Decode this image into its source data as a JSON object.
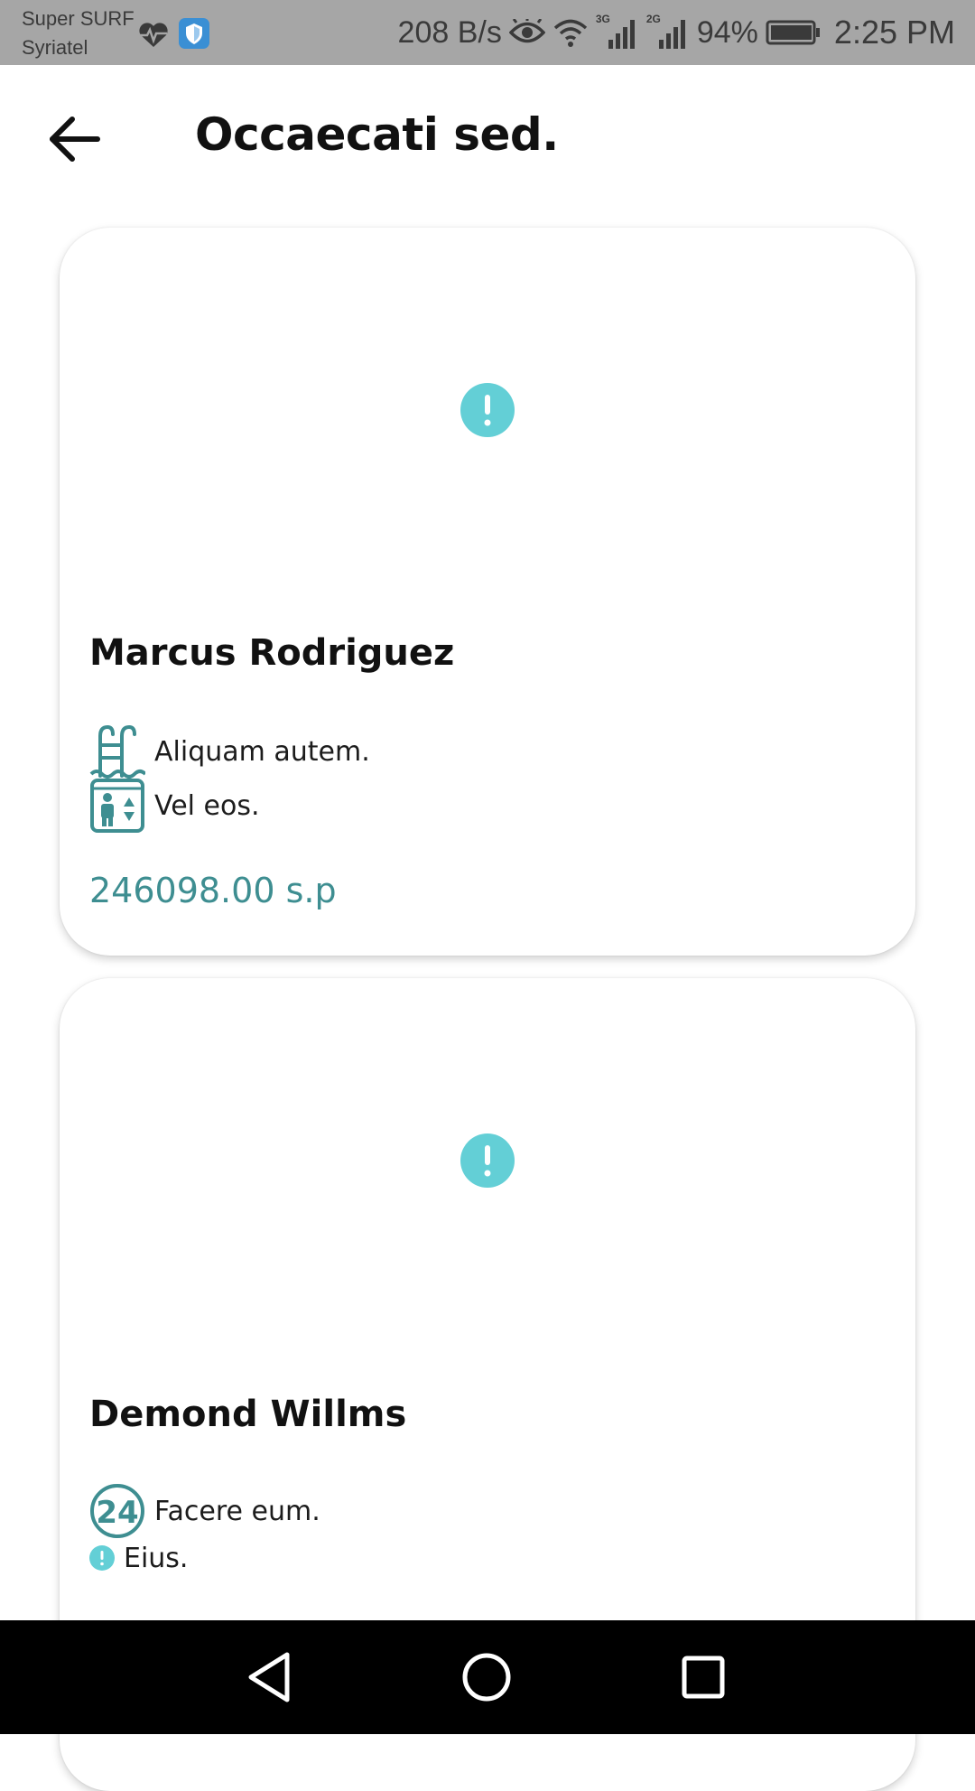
{
  "status_bar": {
    "carrier_line1": "Super SURF",
    "carrier_line2": "Syriatel",
    "net_speed": "208 B/s",
    "signal1_label": "3G",
    "signal2_label": "2G",
    "battery_percent": "94%",
    "time": "2:25 PM",
    "icons": [
      "heart-pulse-icon",
      "shield-icon",
      "eye-icon",
      "wifi-icon",
      "signal-icon",
      "battery-icon"
    ]
  },
  "app_bar": {
    "title": "Occaecati sed.",
    "back_icon": "arrow-left-icon"
  },
  "cards": [
    {
      "name": "Marcus Rodriguez",
      "image_icon": "info-icon",
      "features": [
        {
          "icon": "pool-icon",
          "label": "Aliquam autem."
        },
        {
          "icon": "elevator-icon",
          "label": "Vel eos."
        }
      ],
      "price": "246098.00 s.p"
    },
    {
      "name": "Demond Willms",
      "image_icon": "info-icon",
      "features": [
        {
          "icon": "24-hours-icon",
          "label": "Facere eum."
        },
        {
          "icon": "info-icon",
          "label": "Eius."
        }
      ]
    }
  ],
  "colors": {
    "accent": "#3e8e91",
    "placeholder": "#63cfd6",
    "status_bar_bg": "#a6a6a6",
    "nav_bar_bg": "#000000"
  }
}
